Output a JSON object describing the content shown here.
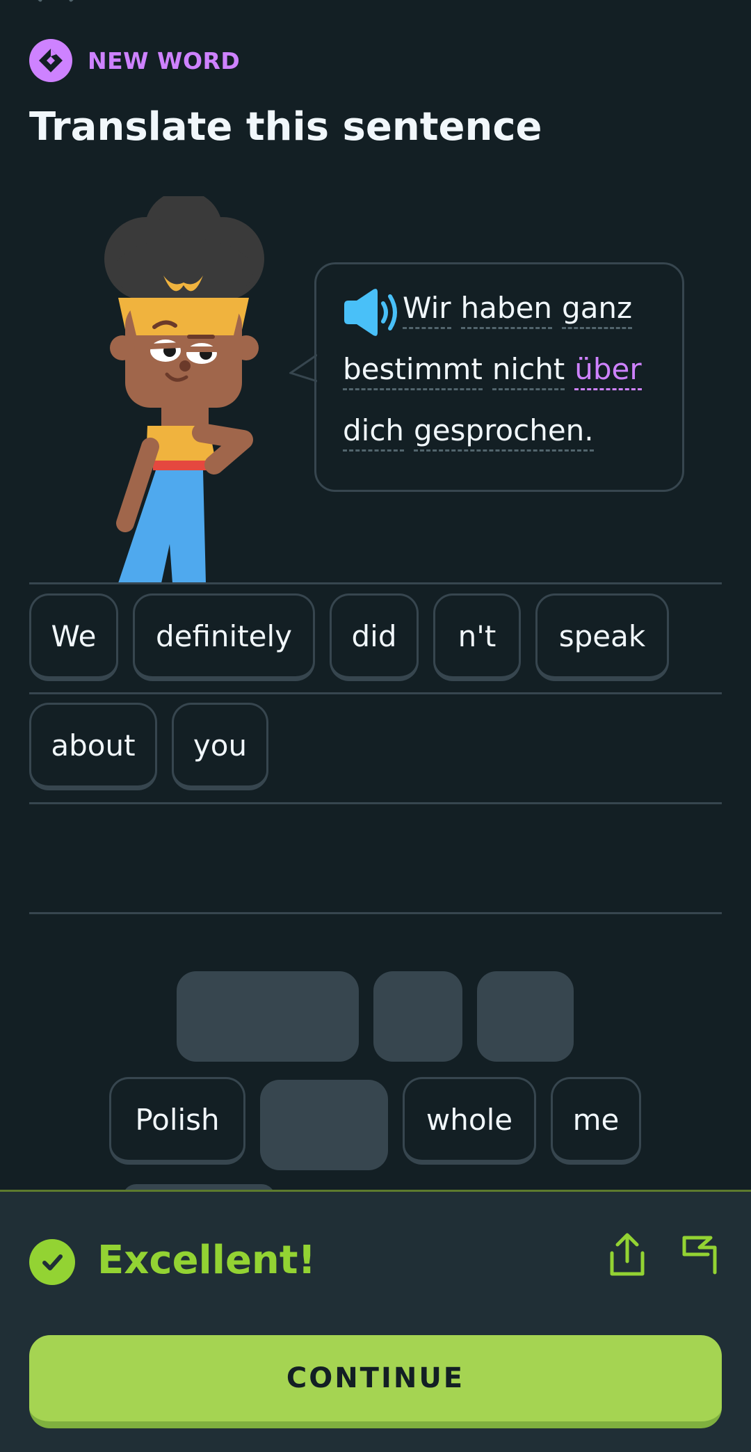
{
  "header": {
    "badge_icon": "gem-icon",
    "badge_label": "NEW WORD",
    "title": "Translate this sentence"
  },
  "speech_bubble": {
    "speaker_icon": "speaker-icon",
    "lines": [
      [
        "Wir",
        "haben",
        "ganz"
      ],
      [
        "bestimmt",
        "nicht",
        "über"
      ],
      [
        "dich",
        "gesprochen."
      ]
    ],
    "highlighted_word": "über"
  },
  "answer": {
    "words": [
      "We",
      "definitely",
      "did",
      "n't",
      "speak",
      "about",
      "you"
    ]
  },
  "word_bank": {
    "visible_words": [
      "Polish",
      "whole",
      "me"
    ]
  },
  "feedback": {
    "status_icon": "check-icon",
    "status_text": "Excellent!",
    "share_icon": "share-icon",
    "report_icon": "flag-icon",
    "continue_label": "CONTINUE"
  },
  "colors": {
    "background": "#131f24",
    "accent_purple": "#ce82ff",
    "success_green": "#93d333",
    "button_green": "#a5d452",
    "footer_bg": "#202f36"
  }
}
